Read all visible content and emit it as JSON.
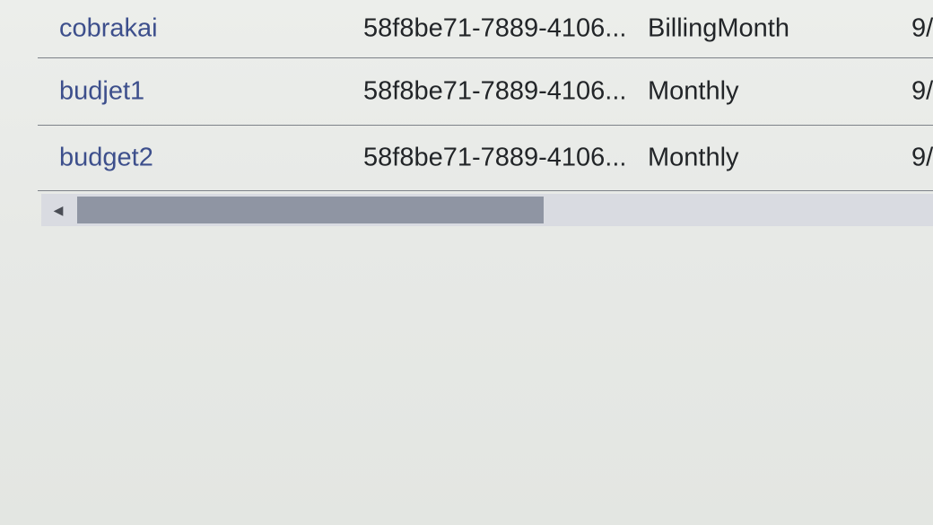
{
  "rows": [
    {
      "name": "cobrakai",
      "id": "58f8be71-7889-4106...",
      "period": "BillingMonth",
      "date": "9/"
    },
    {
      "name": "budjet1",
      "id": "58f8be71-7889-4106...",
      "period": "Monthly",
      "date": "9/"
    },
    {
      "name": "budget2",
      "id": "58f8be71-7889-4106...",
      "period": "Monthly",
      "date": "9/"
    }
  ],
  "scrollbar": {
    "left_arrow": "◀"
  },
  "colors": {
    "link": "#3d4f8c",
    "text": "#222528",
    "scroll_thumb": "#8f95a3",
    "scroll_track": "#d9dbe1"
  }
}
